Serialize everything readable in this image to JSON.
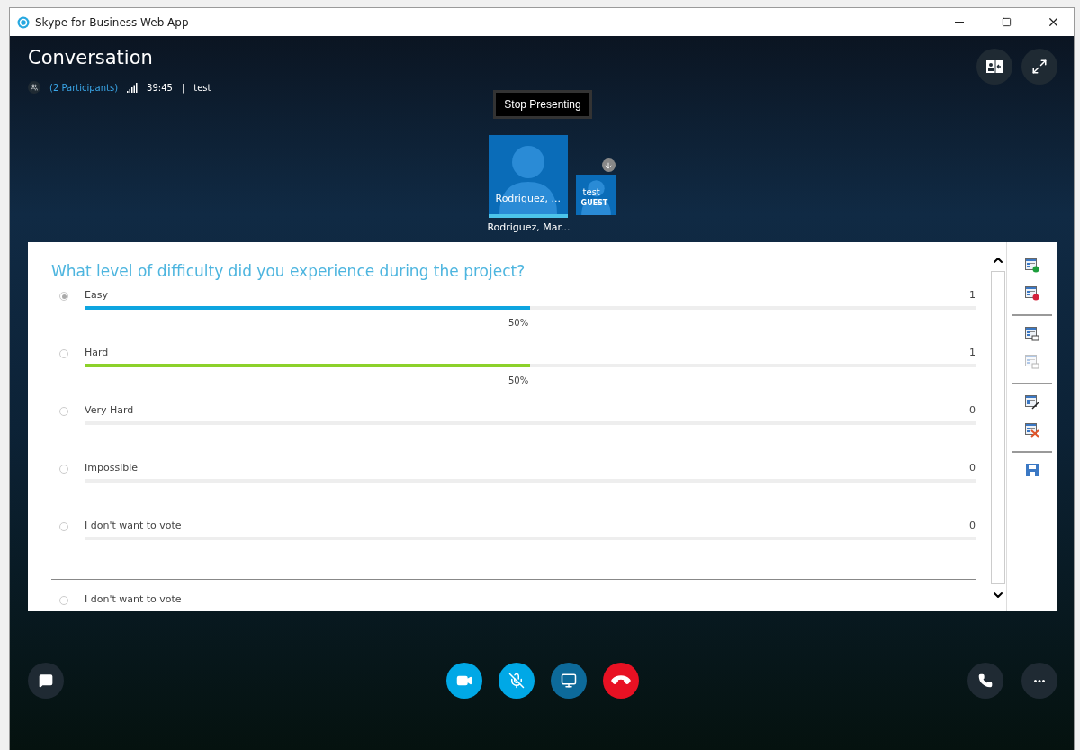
{
  "window": {
    "title": "Skype for Business Web App"
  },
  "header": {
    "title": "Conversation",
    "participants": "(2 Participants)",
    "duration": "39:45",
    "separator": "|",
    "meeting": "test"
  },
  "stop_presenting": "Stop Presenting",
  "participants": [
    {
      "tile_name": "Rodriguez, ...",
      "label": "Rodriguez, Mar...",
      "speaking": true
    },
    {
      "tile_name": "test",
      "role": "GUEST"
    }
  ],
  "poll": {
    "question": "What level of difficulty did you experience during the project?",
    "options": [
      {
        "label": "Easy",
        "count": "1",
        "level": 0.5,
        "percent": "50%",
        "color": "#0ea5e0",
        "selected": true
      },
      {
        "label": "Hard",
        "count": "1",
        "level": 0.5,
        "percent": "50%",
        "color": "#8cd12a",
        "selected": false
      },
      {
        "label": "Very Hard",
        "count": "0",
        "level": 0,
        "selected": false
      },
      {
        "label": "Impossible",
        "count": "0",
        "level": 0,
        "selected": false
      },
      {
        "label": "I don't want to vote",
        "count": "0",
        "level": 0,
        "selected": false
      }
    ],
    "vote_options": [
      {
        "label": "I don't want to vote",
        "selected": false
      }
    ],
    "tool_groups": [
      [
        {
          "kind": "open",
          "disabled": false
        },
        {
          "kind": "close",
          "disabled": false
        }
      ],
      [
        {
          "kind": "show",
          "disabled": false
        },
        {
          "kind": "show",
          "disabled": true
        }
      ],
      [
        {
          "kind": "edit",
          "disabled": false
        },
        {
          "kind": "delete",
          "disabled": false
        }
      ],
      [
        {
          "kind": "save",
          "disabled": false
        }
      ]
    ]
  },
  "controls": {
    "video": {
      "on": false
    },
    "mic": {
      "muted": true
    },
    "present": {
      "on": false
    }
  }
}
